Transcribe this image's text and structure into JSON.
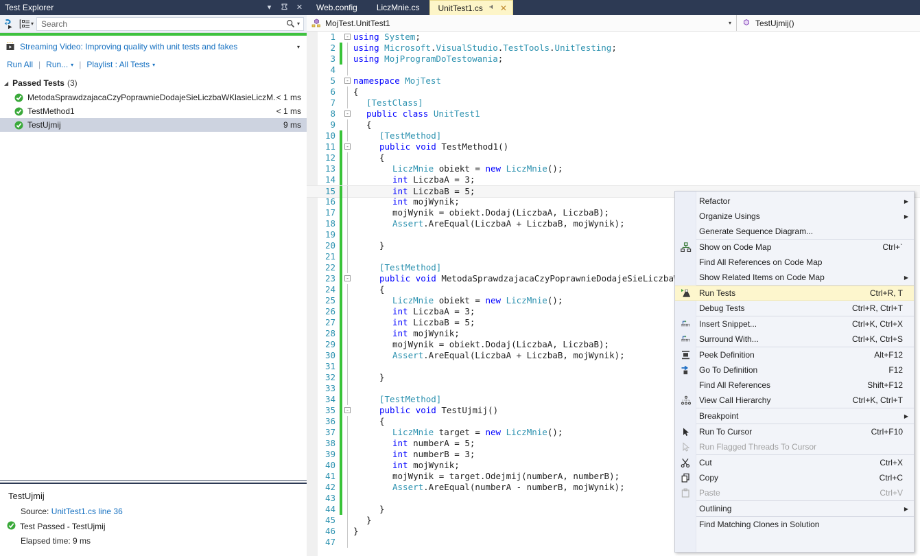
{
  "test_explorer": {
    "title": "Test Explorer",
    "title_buttons": [
      {
        "name": "dropdown",
        "glyph": "▾"
      },
      {
        "name": "pin",
        "glyph": "⌐"
      },
      {
        "name": "close",
        "glyph": "✕"
      }
    ],
    "toolbar": {
      "run_icon": "run-tests-icon",
      "group_icon": "group-by-icon",
      "group_caret": "▾",
      "search_placeholder": "Search",
      "search_icon": "search-icon",
      "search_caret": "▾"
    },
    "status_bar_color": "#3fc23f",
    "video_link": "Streaming Video: Improving quality with unit tests and fakes",
    "video_caret": "▾",
    "commands": {
      "run_all": "Run All",
      "run": "Run...",
      "playlist": "Playlist : All Tests",
      "separator": "|",
      "caret": "▾"
    },
    "group": {
      "triangle": "◢",
      "label": "Passed Tests",
      "count": "(3)"
    },
    "tests": [
      {
        "name": "MetodaSprawdzajacaCzyPoprawnieDodajeSieLiczbaWKlasieLiczM...",
        "duration": "< 1 ms",
        "status": "passed",
        "selected": false
      },
      {
        "name": "TestMethod1",
        "duration": "< 1 ms",
        "status": "passed",
        "selected": false
      },
      {
        "name": "TestUjmij",
        "duration": "9 ms",
        "status": "passed",
        "selected": true
      }
    ],
    "detail": {
      "title": "TestUjmij",
      "source_label": "Source:",
      "source_link": "UnitTest1.cs line 36",
      "result": "Test Passed - TestUjmij",
      "elapsed": "Elapsed time: 9 ms"
    }
  },
  "editor": {
    "tabs": [
      {
        "label": "Web.config",
        "active": false
      },
      {
        "label": "LiczMnie.cs",
        "active": false
      },
      {
        "label": "UnitTest1.cs",
        "active": true,
        "pin": "⌐",
        "close": "✕"
      }
    ],
    "nav_bar": {
      "type_icon": "class-icon",
      "type_value": "MojTest.UnitTest1",
      "type_caret": "▾",
      "member_icon": "method-icon",
      "member_value": "TestUjmij()"
    },
    "code": [
      {
        "n": "1",
        "fold": "-",
        "indent": 0,
        "text": "using System;"
      },
      {
        "n": "2",
        "change": true,
        "indent": 0,
        "text": "using Microsoft.VisualStudio.TestTools.UnitTesting;"
      },
      {
        "n": "3",
        "change": true,
        "indent": 0,
        "text": "using MojProgramDoTestowania;"
      },
      {
        "n": "4",
        "indent": 0,
        "text": ""
      },
      {
        "n": "5",
        "fold": "-",
        "indent": 0,
        "text": "namespace MojTest"
      },
      {
        "n": "6",
        "indent": 0,
        "text": "{"
      },
      {
        "n": "7",
        "indent": 1,
        "text": "[TestClass]"
      },
      {
        "n": "8",
        "fold": "-",
        "indent": 1,
        "text": "public class UnitTest1"
      },
      {
        "n": "9",
        "indent": 1,
        "text": "{"
      },
      {
        "n": "10",
        "change": true,
        "indent": 2,
        "text": "[TestMethod]"
      },
      {
        "n": "11",
        "change": true,
        "fold": "-",
        "indent": 2,
        "text": "public void TestMethod1()"
      },
      {
        "n": "12",
        "change": true,
        "indent": 2,
        "text": "{"
      },
      {
        "n": "13",
        "change": true,
        "indent": 3,
        "text": "LiczMnie obiekt = new LiczMnie();"
      },
      {
        "n": "14",
        "change": true,
        "indent": 3,
        "text": "int LiczbaA = 3;"
      },
      {
        "n": "15",
        "change": true,
        "current": true,
        "indent": 3,
        "text": "int LiczbaB = 5;"
      },
      {
        "n": "16",
        "change": true,
        "indent": 3,
        "text": "int mojWynik;"
      },
      {
        "n": "17",
        "change": true,
        "indent": 3,
        "text": "mojWynik = obiekt.Dodaj(LiczbaA, LiczbaB);"
      },
      {
        "n": "18",
        "change": true,
        "indent": 3,
        "text": "Assert.AreEqual(LiczbaA + LiczbaB, mojWynik);"
      },
      {
        "n": "19",
        "change": true,
        "indent": 3,
        "text": ""
      },
      {
        "n": "20",
        "change": true,
        "indent": 2,
        "text": "}"
      },
      {
        "n": "21",
        "change": true,
        "indent": 2,
        "text": ""
      },
      {
        "n": "22",
        "change": true,
        "indent": 2,
        "text": "[TestMethod]"
      },
      {
        "n": "23",
        "change": true,
        "fold": "-",
        "indent": 2,
        "text": "public void MetodaSprawdzajacaCzyPoprawnieDodajeSieLiczbaWKlasieLiczMnie()"
      },
      {
        "n": "24",
        "change": true,
        "indent": 2,
        "text": "{"
      },
      {
        "n": "25",
        "change": true,
        "indent": 3,
        "text": "LiczMnie obiekt = new LiczMnie();"
      },
      {
        "n": "26",
        "change": true,
        "indent": 3,
        "text": "int LiczbaA = 3;"
      },
      {
        "n": "27",
        "change": true,
        "indent": 3,
        "text": "int LiczbaB = 5;"
      },
      {
        "n": "28",
        "change": true,
        "indent": 3,
        "text": "int mojWynik;"
      },
      {
        "n": "29",
        "change": true,
        "indent": 3,
        "text": "mojWynik = obiekt.Dodaj(LiczbaA, LiczbaB);"
      },
      {
        "n": "30",
        "change": true,
        "indent": 3,
        "text": "Assert.AreEqual(LiczbaA + LiczbaB, mojWynik);"
      },
      {
        "n": "31",
        "change": true,
        "indent": 3,
        "text": ""
      },
      {
        "n": "32",
        "change": true,
        "indent": 2,
        "text": "}"
      },
      {
        "n": "33",
        "change": true,
        "indent": 2,
        "text": ""
      },
      {
        "n": "34",
        "change": true,
        "indent": 2,
        "text": "[TestMethod]"
      },
      {
        "n": "35",
        "change": true,
        "fold": "-",
        "indent": 2,
        "text": "public void TestUjmij()"
      },
      {
        "n": "36",
        "change": true,
        "indent": 2,
        "text": "{"
      },
      {
        "n": "37",
        "change": true,
        "indent": 3,
        "text": "LiczMnie target = new LiczMnie();"
      },
      {
        "n": "38",
        "change": true,
        "indent": 3,
        "text": "int numberA = 5;"
      },
      {
        "n": "39",
        "change": true,
        "indent": 3,
        "text": "int numberB = 3;"
      },
      {
        "n": "40",
        "change": true,
        "indent": 3,
        "text": "int mojWynik;"
      },
      {
        "n": "41",
        "change": true,
        "indent": 3,
        "text": "mojWynik = target.Odejmij(numberA, numberB);"
      },
      {
        "n": "42",
        "change": true,
        "indent": 3,
        "text": "Assert.AreEqual(numberA - numberB, mojWynik);"
      },
      {
        "n": "43",
        "change": true,
        "indent": 3,
        "text": ""
      },
      {
        "n": "44",
        "change": true,
        "indent": 2,
        "text": "}"
      },
      {
        "n": "45",
        "indent": 1,
        "text": "}"
      },
      {
        "n": "46",
        "indent": 0,
        "text": "}"
      },
      {
        "n": "47",
        "indent": 0,
        "text": ""
      }
    ]
  },
  "context_menu": {
    "items": [
      {
        "label": "Refactor",
        "shortcut": "",
        "icon": "",
        "submenu": true
      },
      {
        "label": "Organize Usings",
        "shortcut": "",
        "icon": "",
        "submenu": true
      },
      {
        "label": "Generate Sequence Diagram...",
        "shortcut": "",
        "icon": "",
        "submenu": false
      },
      {
        "separator": true
      },
      {
        "label": "Show on Code Map",
        "shortcut": "Ctrl+`",
        "icon": "code-map-icon",
        "submenu": false
      },
      {
        "label": "Find All References on Code Map",
        "shortcut": "",
        "icon": "",
        "submenu": false
      },
      {
        "label": "Show Related Items on Code Map",
        "shortcut": "",
        "icon": "",
        "submenu": true
      },
      {
        "separator": true
      },
      {
        "label": "Run Tests",
        "shortcut": "Ctrl+R, T",
        "icon": "run-tests-flask-icon",
        "submenu": false,
        "highlight": true
      },
      {
        "label": "Debug Tests",
        "shortcut": "Ctrl+R, Ctrl+T",
        "icon": "",
        "submenu": false
      },
      {
        "separator": true
      },
      {
        "label": "Insert Snippet...",
        "shortcut": "Ctrl+K, Ctrl+X",
        "icon": "insert-snippet-icon",
        "submenu": false
      },
      {
        "label": "Surround With...",
        "shortcut": "Ctrl+K, Ctrl+S",
        "icon": "surround-with-icon",
        "submenu": false
      },
      {
        "separator": true
      },
      {
        "label": "Peek Definition",
        "shortcut": "Alt+F12",
        "icon": "peek-definition-icon",
        "submenu": false
      },
      {
        "label": "Go To Definition",
        "shortcut": "F12",
        "icon": "go-to-definition-icon",
        "submenu": false
      },
      {
        "label": "Find All References",
        "shortcut": "Shift+F12",
        "icon": "",
        "submenu": false
      },
      {
        "label": "View Call Hierarchy",
        "shortcut": "Ctrl+K, Ctrl+T",
        "icon": "call-hierarchy-icon",
        "submenu": false
      },
      {
        "separator": true
      },
      {
        "label": "Breakpoint",
        "shortcut": "",
        "icon": "",
        "submenu": true
      },
      {
        "separator": true
      },
      {
        "label": "Run To Cursor",
        "shortcut": "Ctrl+F10",
        "icon": "cursor-arrow-icon",
        "submenu": false
      },
      {
        "label": "Run Flagged Threads To Cursor",
        "shortcut": "",
        "icon": "cursor-arrow-icon",
        "submenu": false,
        "disabled": true
      },
      {
        "separator": true
      },
      {
        "label": "Cut",
        "shortcut": "Ctrl+X",
        "icon": "scissors-icon",
        "submenu": false
      },
      {
        "label": "Copy",
        "shortcut": "Ctrl+C",
        "icon": "copy-icon",
        "submenu": false
      },
      {
        "label": "Paste",
        "shortcut": "Ctrl+V",
        "icon": "paste-icon",
        "submenu": false,
        "disabled": true
      },
      {
        "separator": true
      },
      {
        "label": "Outlining",
        "shortcut": "",
        "icon": "",
        "submenu": true
      },
      {
        "separator": true
      },
      {
        "label": "Find Matching Clones in Solution",
        "shortcut": "",
        "icon": "",
        "submenu": false
      }
    ]
  }
}
